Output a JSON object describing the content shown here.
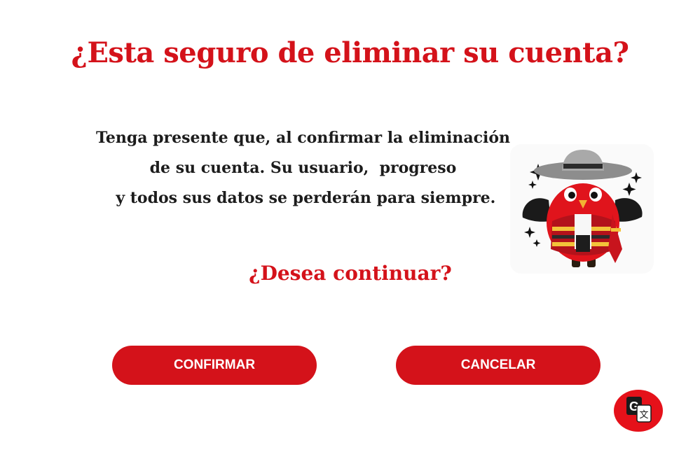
{
  "dialog": {
    "title": "¿Esta seguro de eliminar su cuenta?",
    "message_lines": [
      "Tenga presente que, al confirmar la eliminación",
      "de su cuenta. Su usuario,  progreso",
      " y todos sus datos se perderán para siempre."
    ],
    "question": "¿Desea continuar?",
    "confirm_label": "CONFIRMAR",
    "cancel_label": "CANCELAR"
  },
  "mascot": {
    "icon": "bird-mascot-icon"
  },
  "translate_widget": {
    "icon": "translate-icon"
  },
  "colors": {
    "accent": "#d4121a",
    "text": "#1c1c1c",
    "button_text": "#ffffff",
    "background": "#ffffff"
  }
}
